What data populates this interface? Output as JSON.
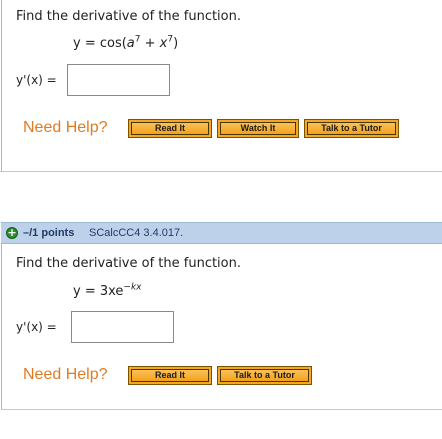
{
  "question1": {
    "prompt": "Find the derivative of the function.",
    "eq_prefix": "y = cos(",
    "eq_a": "a",
    "eq_a_exp": "7",
    "eq_plus": " + ",
    "eq_x": "x",
    "eq_x_exp": "7",
    "eq_suffix": ")",
    "answer_label": "y'(x) =",
    "answer_value": ""
  },
  "question1_help": {
    "label": "Need Help?",
    "buttons": [
      "Read It",
      "Watch It",
      "Talk to a Tutor"
    ]
  },
  "question2": {
    "points": "–/1 points",
    "id": "SCalcCC4 3.4.017.",
    "prompt": "Find the derivative of the function.",
    "eq_prefix": "y = 3xe",
    "eq_exp": "−kx",
    "answer_label": "y'(x) =",
    "answer_value": ""
  },
  "question2_help": {
    "label": "Need Help?",
    "buttons": [
      "Read It",
      "Talk to a Tutor"
    ]
  },
  "icons": {
    "expand": "plus-circle-icon"
  },
  "colors": {
    "need_help": "#e07b23",
    "button": "#f5a623",
    "header_bg": "#bdd2ea"
  }
}
